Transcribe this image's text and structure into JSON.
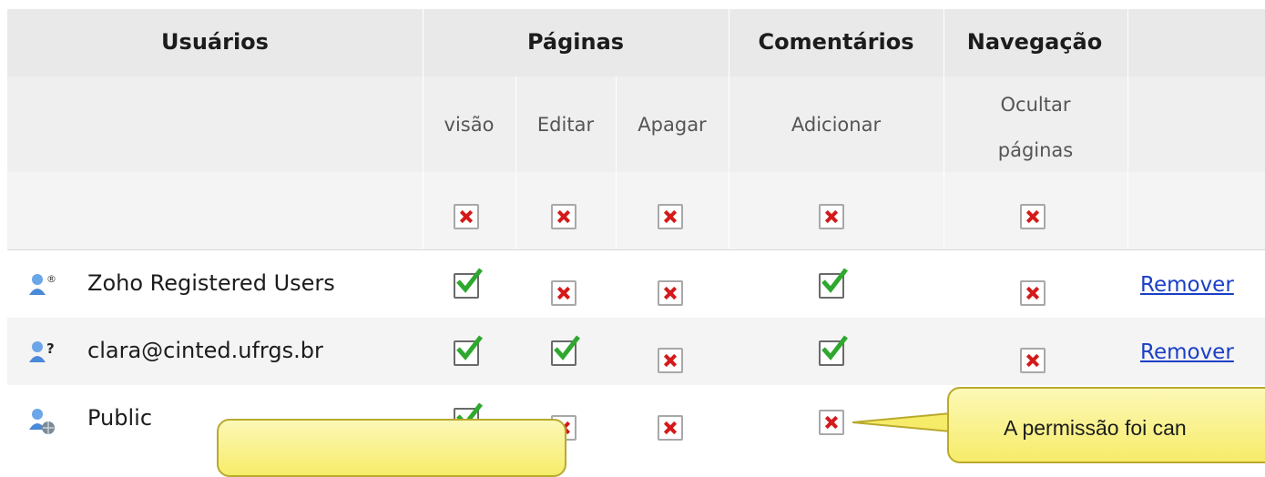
{
  "headers": {
    "users": "Usuários",
    "pages": "Páginas",
    "comments": "Comentários",
    "navigation": "Navegação"
  },
  "subheaders": {
    "view": "visão",
    "edit": "Editar",
    "delete": "Apagar",
    "add": "Adicionar",
    "hide_pages_line1": "Ocultar",
    "hide_pages_line2": "páginas"
  },
  "users": [
    {
      "name": "Zoho Registered Users",
      "icon": "registered-users-icon",
      "view": true,
      "edit": false,
      "delete": false,
      "add": true,
      "hide": false,
      "remove": "Remover"
    },
    {
      "name": "clara@cinted.ufrgs.br",
      "icon": "unknown-user-icon",
      "view": true,
      "edit": true,
      "delete": false,
      "add": true,
      "hide": false,
      "remove": "Remover"
    },
    {
      "name": "Public",
      "icon": "public-user-icon",
      "view": true,
      "edit": false,
      "delete": false,
      "add": false,
      "hide": false
    }
  ],
  "all_row": {
    "view": false,
    "edit": false,
    "delete": false,
    "add": false,
    "hide": false
  },
  "tooltip": {
    "text": "A permissão foi can"
  },
  "colors": {
    "check_green": "#2ea82e",
    "cross_red": "#d41a1a",
    "link_blue": "#1a3fc6",
    "tooltip_yellow": "#f6ec6a"
  }
}
